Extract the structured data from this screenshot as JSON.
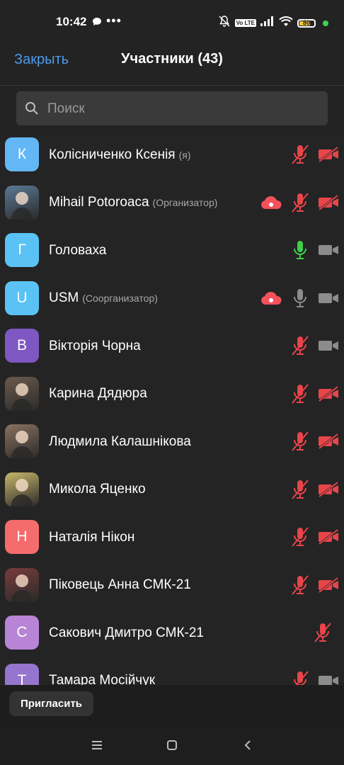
{
  "status": {
    "time": "10:42",
    "battery": "80",
    "lte": "Vo LTE"
  },
  "header": {
    "close_label": "Закрыть",
    "title": "Участники (43)"
  },
  "search": {
    "placeholder": "Поиск"
  },
  "participants": [
    {
      "name": "Колісниченко Ксенія",
      "role": "(я)",
      "avatar_letter": "К",
      "avatar_color": "#63b7f5",
      "photo": false,
      "recording": false,
      "mic": "muted",
      "video": "off"
    },
    {
      "name": "Mihail Potoroaca",
      "role": "(Организатор)",
      "avatar_letter": "",
      "avatar_color": "#5a7a95",
      "photo": true,
      "recording": true,
      "mic": "muted",
      "video": "off"
    },
    {
      "name": "Головаха",
      "role": "",
      "avatar_letter": "Г",
      "avatar_color": "#5bc2f5",
      "photo": false,
      "recording": false,
      "mic": "active",
      "video": "on"
    },
    {
      "name": "USM",
      "role": "(Соорганизатор)",
      "avatar_letter": "U",
      "avatar_color": "#5bc2f5",
      "photo": false,
      "recording": true,
      "mic": "on",
      "video": "on"
    },
    {
      "name": "Вікторія Чорна",
      "role": "",
      "avatar_letter": "В",
      "avatar_color": "#7e57c2",
      "photo": false,
      "recording": false,
      "mic": "muted",
      "video": "on"
    },
    {
      "name": "Карина Дядюра",
      "role": "",
      "avatar_letter": "",
      "avatar_color": "#6b5a4c",
      "photo": true,
      "recording": false,
      "mic": "muted",
      "video": "off"
    },
    {
      "name": "Людмила Калашнікова",
      "role": "",
      "avatar_letter": "",
      "avatar_color": "#8a7260",
      "photo": true,
      "recording": false,
      "mic": "muted",
      "video": "off"
    },
    {
      "name": "Микола Яценко",
      "role": "",
      "avatar_letter": "",
      "avatar_color": "#c9b76a",
      "photo": true,
      "recording": false,
      "mic": "muted",
      "video": "off"
    },
    {
      "name": "Наталія Нікон",
      "role": "",
      "avatar_letter": "Н",
      "avatar_color": "#f56c6c",
      "photo": false,
      "recording": false,
      "mic": "muted",
      "video": "off"
    },
    {
      "name": "Піковець Анна СМК-21",
      "role": "",
      "avatar_letter": "",
      "avatar_color": "#7a3b3b",
      "photo": true,
      "recording": false,
      "mic": "muted",
      "video": "off"
    },
    {
      "name": "Сакович Дмитро СМК-21",
      "role": "",
      "avatar_letter": "С",
      "avatar_color": "#b884d6",
      "photo": false,
      "recording": false,
      "mic": "muted",
      "video": "none"
    },
    {
      "name": "Тамара Мосійчук",
      "role": "",
      "avatar_letter": "Т",
      "avatar_color": "#9575cd",
      "photo": false,
      "recording": false,
      "mic": "muted",
      "video": "on"
    }
  ],
  "footer": {
    "invite_label": "Пригласить"
  },
  "colors": {
    "accent": "#4d9bf0",
    "muted_red": "#e8454a",
    "active_green": "#3fcf4a",
    "icon_grey": "#8c8c8c"
  }
}
